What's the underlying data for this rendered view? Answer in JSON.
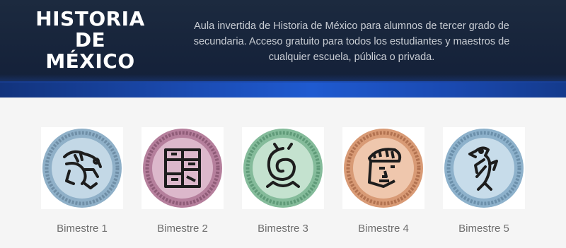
{
  "header": {
    "title": "HISTORIA\nDE\nMÉXICO",
    "description": "Aula invertida de Historia de México para alumnos de tercer grado de secundaria. Acceso gratuito para todos los estudiantes y maestros de cualquier escuela, pública o privada."
  },
  "bimestres": [
    {
      "label": "Bimestre 1",
      "icon": "lizard-glyph-icon",
      "ring": "#8fb0c8",
      "inner": "#c3d8e6"
    },
    {
      "label": "Bimestre 2",
      "icon": "temple-glyph-icon",
      "ring": "#b57f9c",
      "inner": "#dcb8cb"
    },
    {
      "label": "Bimestre 3",
      "icon": "spiral-glyph-icon",
      "ring": "#84bb9a",
      "inner": "#c4e2cf"
    },
    {
      "label": "Bimestre 4",
      "icon": "warrior-head-glyph-icon",
      "ring": "#d89a75",
      "inner": "#efc7ad"
    },
    {
      "label": "Bimestre 5",
      "icon": "eagle-glyph-icon",
      "ring": "#8db1cb",
      "inner": "#c7dcea"
    }
  ]
}
